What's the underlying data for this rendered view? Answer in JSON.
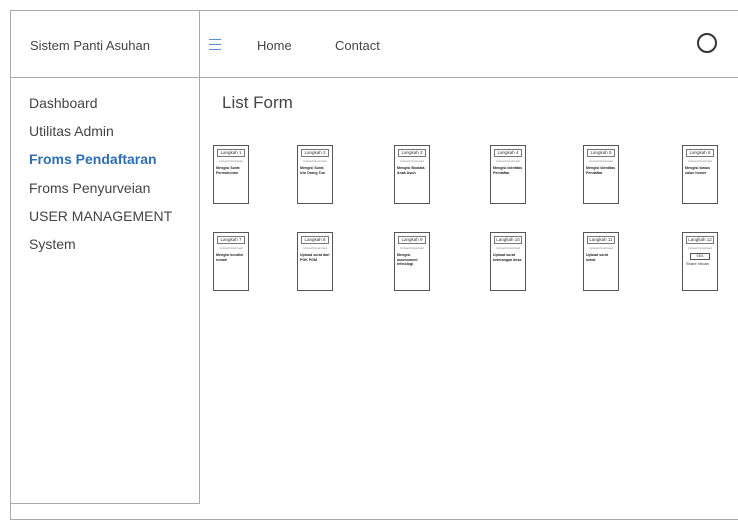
{
  "header": {
    "brand": "Sistem Panti Asuhan",
    "nav": [
      "Home",
      "Contact"
    ]
  },
  "sidebar": {
    "items": [
      {
        "label": "Dashboard",
        "active": false
      },
      {
        "label": "Utilitas Admin",
        "active": false
      },
      {
        "label": "Froms Pendaftaran",
        "active": true
      },
      {
        "label": "Froms Penyurveian",
        "active": false
      },
      {
        "label": "USER MANAGEMENT",
        "active": false
      },
      {
        "label": "System",
        "active": false
      }
    ]
  },
  "main": {
    "title": "List Form",
    "cards": [
      {
        "title": "Langkah 1",
        "sub": "Upload Download",
        "desc": "Mengisi Surat Permohonan"
      },
      {
        "title": "Langkah 2",
        "sub": "Upload Download",
        "desc": "Mengisi Surat Izin Orang Tua"
      },
      {
        "title": "Langkah 3",
        "sub": "Upload Download",
        "desc": "Mengisi Biodata Anak Asuh"
      },
      {
        "title": "Langkah 4",
        "sub": "Upload Download",
        "desc": "Mengisi Identitas Pendaftar"
      },
      {
        "title": "Langkah 5",
        "sub": "Upload Download",
        "desc": "Mengisi Identitas Pendaftar"
      },
      {
        "title": "Langkah 6",
        "sub": "Upload Download",
        "desc": "Mengisi status calon homer"
      },
      {
        "title": "Langkah 7",
        "sub": "Upload Download",
        "desc": "Mengisi kondisi rumah"
      },
      {
        "title": "Langkah 8",
        "sub": "Upload Download",
        "desc": "Upload surat dari PGK PGM"
      },
      {
        "title": "Langkah 9",
        "sub": "Upload Download",
        "desc": "Mengisi assessment tehnologi"
      },
      {
        "title": "Langkah 10",
        "sub": "Upload Download",
        "desc": "Upload surat keterangan desa"
      },
      {
        "title": "Langkah 11",
        "sub": "Upload Download",
        "desc": "Upload surat sehat"
      },
      {
        "title": "Langkah 12",
        "sub": "Upload Download",
        "desc": "",
        "button": "SEA",
        "share": "Share Infoan"
      }
    ]
  },
  "icons": {
    "menu": "hamburger-menu-icon",
    "profile": "profile-circle-icon"
  }
}
